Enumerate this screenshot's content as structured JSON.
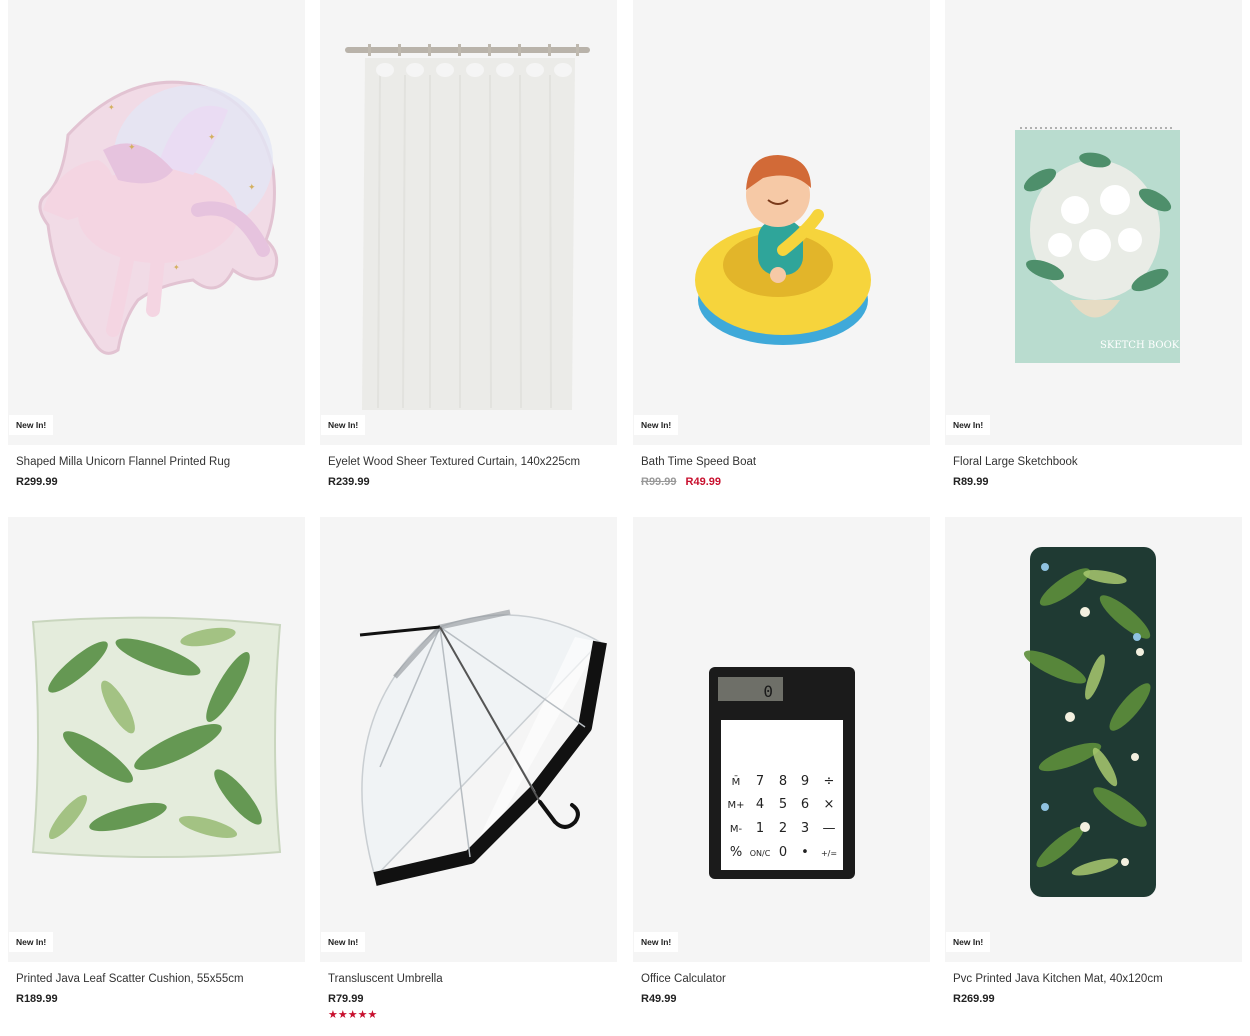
{
  "products": [
    {
      "title": "Shaped Milla Unicorn Flannel Printed Rug",
      "badge": "New In!",
      "price": "R299.99",
      "icon": "unicorn-rug"
    },
    {
      "title": "Eyelet Wood Sheer Textured Curtain, 140x225cm",
      "badge": "New In!",
      "price": "R239.99",
      "icon": "sheer-curtain"
    },
    {
      "title": "Bath Time Speed Boat",
      "badge": "New In!",
      "old_price": "R99.99",
      "sale_price": "R49.99",
      "icon": "toy-boat"
    },
    {
      "title": "Floral Large Sketchbook",
      "badge": "New In!",
      "price": "R89.99",
      "icon": "sketchbook"
    },
    {
      "title": "Printed Java Leaf Scatter Cushion, 55x55cm",
      "badge": "New In!",
      "price": "R189.99",
      "icon": "leaf-cushion"
    },
    {
      "title": "Transluscent Umbrella",
      "badge": "New In!",
      "price": "R79.99",
      "rating": "★★★★★",
      "icon": "umbrella"
    },
    {
      "title": "Office Calculator",
      "badge": "New In!",
      "price": "R49.99",
      "icon": "calculator"
    },
    {
      "title": "Pvc Printed Java Kitchen Mat, 40x120cm",
      "badge": "New In!",
      "price": "R269.99",
      "icon": "kitchen-mat"
    }
  ],
  "calculator": {
    "display": "0",
    "keys": [
      [
        "M̄",
        "7",
        "8",
        "9",
        "÷"
      ],
      [
        "M+",
        "4",
        "5",
        "6",
        "×"
      ],
      [
        "M-",
        "1",
        "2",
        "3",
        "—"
      ],
      [
        "%",
        "ON/C",
        "0",
        "•",
        "+/="
      ]
    ]
  },
  "sketchbook": {
    "cover_text": "SKETCH BOOK"
  },
  "colors": {
    "sale": "#c8102e",
    "card_bg": "#f5f5f5"
  }
}
